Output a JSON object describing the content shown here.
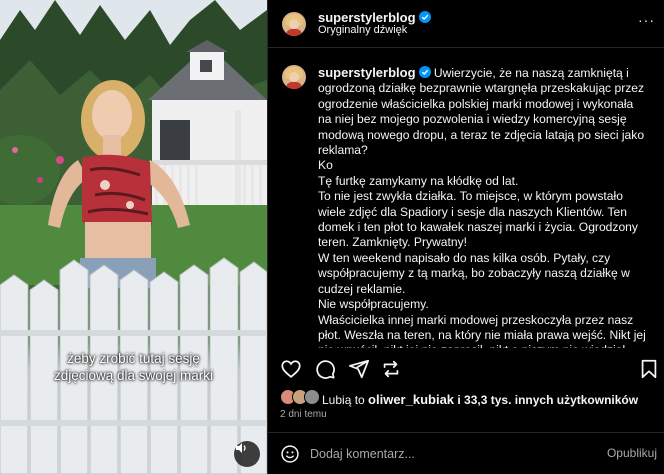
{
  "post": {
    "username": "superstylerblog",
    "audio": "Oryginalny dźwięk",
    "more": "···"
  },
  "media": {
    "caption_line1": "żeby zrobić tutaj sesję",
    "caption_line2": "zdjęciową dla swojej marki"
  },
  "caption": {
    "username": "superstylerblog",
    "lines": [
      "Uwierzycie, że na naszą zamkniętą i ogrodzoną działkę bezprawnie wtargnęła przeskakując przez ogrodzenie właścicielka polskiej marki modowej i wykonała na niej bez mojego pozwolenia i wiedzy komercyjną sesję modową nowego dropu, a teraz te zdjęcia latają po sieci jako reklama?",
      "Ko",
      "Tę furtkę zamykamy na kłódkę od lat.",
      "To nie jest zwykła działka. To miejsce, w którym powstało wiele zdjęć dla Spadiory i sesje dla naszych Klientów. Ten domek i ten płot to kawałek naszej marki i życia. Ogrodzony teren. Zamknięty. Prywatny!",
      "W ten weekend napisało do nas kilka osób. Pytały, czy współpracujemy z tą marką, bo zobaczyły naszą działkę w cudzej reklamie.",
      "Nie współpracujemy.",
      "Właścicielka innej marki modowej przeskoczyła przez nasz płot. Weszła na teren, na który nie miała prawa wejść. Nikt jej nie wpuścił, nikt jej nie zaprosił, nikt o niczym nie wiedział, nie pytała o zgodę. Nie tylko weszła na nasz teren, ale również położyła się"
    ]
  },
  "likes": {
    "prefix": "Lubią to ",
    "user": "oliwer_kubiak",
    "suffix": " i 33,3 tys. innych użytkowników"
  },
  "date": "2 dni temu",
  "comment": {
    "placeholder": "Dodaj komentarz...",
    "publish": "Opublikuj"
  },
  "icons": [
    "verified-badge-icon",
    "heart-icon",
    "comment-icon",
    "share-icon",
    "bookmark-icon",
    "emoji-icon",
    "volume-icon"
  ],
  "colors": {
    "accent": "#0095f6",
    "background": "#000000",
    "text": "#f5f5f5",
    "muted": "#a8a8a8"
  }
}
